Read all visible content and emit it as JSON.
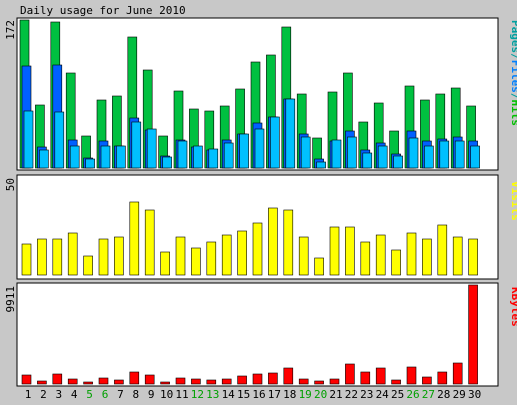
{
  "chart_data": [
    {
      "type": "bar",
      "title": "Daily usage for June 2010",
      "ylabel_parts": [
        {
          "text": "Pages",
          "color": "#00a0a0"
        },
        {
          "text": "/",
          "color": "#00a0a0"
        },
        {
          "text": "Files",
          "color": "#0080ff"
        },
        {
          "text": "/",
          "color": "#00a0a0"
        },
        {
          "text": "Hits",
          "color": "#00c000"
        }
      ],
      "ymax_label": "172",
      "ylim": [
        0,
        172
      ],
      "categories": [
        "1",
        "2",
        "3",
        "4",
        "5",
        "6",
        "7",
        "8",
        "9",
        "10",
        "11",
        "12",
        "13",
        "14",
        "15",
        "16",
        "17",
        "18",
        "19",
        "20",
        "21",
        "22",
        "23",
        "24",
        "25",
        "26",
        "27",
        "28",
        "29",
        "30"
      ],
      "weekend_days": [
        "5",
        "6",
        "12",
        "13",
        "19",
        "20",
        "26",
        "27"
      ],
      "series": [
        {
          "name": "Hits",
          "color": "#00c040",
          "values": [
            172,
            73,
            170,
            110,
            37,
            79,
            84,
            152,
            114,
            37,
            89,
            68,
            66,
            72,
            92,
            123,
            131,
            164,
            86,
            35,
            88,
            110,
            54,
            76,
            43,
            95,
            79,
            86,
            93,
            72
          ]
        },
        {
          "name": "Files",
          "color": "#0060ff",
          "values": [
            118,
            24,
            120,
            33,
            12,
            31,
            26,
            58,
            44,
            14,
            32,
            24,
            21,
            33,
            40,
            52,
            59,
            80,
            40,
            10,
            31,
            43,
            21,
            29,
            16,
            43,
            31,
            34,
            36,
            31
          ]
        },
        {
          "name": "Pages",
          "color": "#00c0ff",
          "values": [
            66,
            21,
            65,
            26,
            11,
            25,
            26,
            53,
            45,
            13,
            31,
            25,
            22,
            29,
            39,
            45,
            59,
            80,
            36,
            7,
            32,
            36,
            18,
            26,
            14,
            35,
            26,
            31,
            31,
            25
          ]
        }
      ]
    },
    {
      "type": "bar",
      "ylabel": "Visits",
      "ylabel_color": "#ffff00",
      "ymax_label": "50",
      "ylim": [
        0,
        50
      ],
      "series": [
        {
          "name": "Visits",
          "color": "#ffff00",
          "values": [
            16,
            19,
            19,
            22,
            10,
            19,
            20,
            38,
            34,
            12,
            20,
            14,
            17,
            21,
            23,
            27,
            35,
            34,
            20,
            9,
            25,
            25,
            17,
            21,
            13,
            22,
            19,
            26,
            20,
            19
          ]
        }
      ]
    },
    {
      "type": "bar",
      "ylabel": "KBytes",
      "ylabel_color": "#ff0000",
      "ymax_label": "9911",
      "ylim": [
        0,
        9911
      ],
      "series": [
        {
          "name": "KBytes",
          "color": "#ff0000",
          "values": [
            900,
            300,
            1000,
            500,
            200,
            600,
            450,
            1200,
            950,
            250,
            600,
            500,
            450,
            500,
            800,
            1000,
            1150,
            1600,
            550,
            300,
            550,
            2000,
            1200,
            1600,
            450,
            1750,
            700,
            1250,
            2100,
            9911
          ]
        }
      ]
    }
  ]
}
